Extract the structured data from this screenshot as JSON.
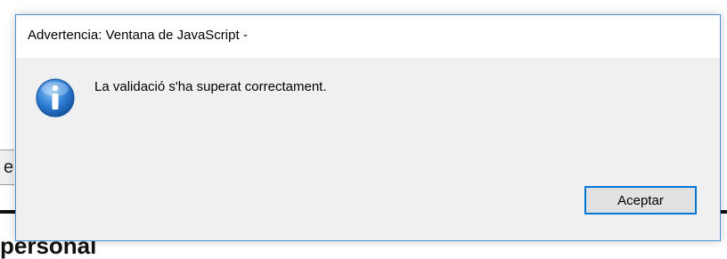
{
  "background": {
    "partial_char": "e",
    "heading_fragment": "personal"
  },
  "dialog": {
    "title": "Advertencia: Ventana de JavaScript -",
    "message": "La validació s'ha superat correctament.",
    "icon": "info-icon",
    "ok_label": "Aceptar",
    "accent_color": "#0078d7"
  }
}
